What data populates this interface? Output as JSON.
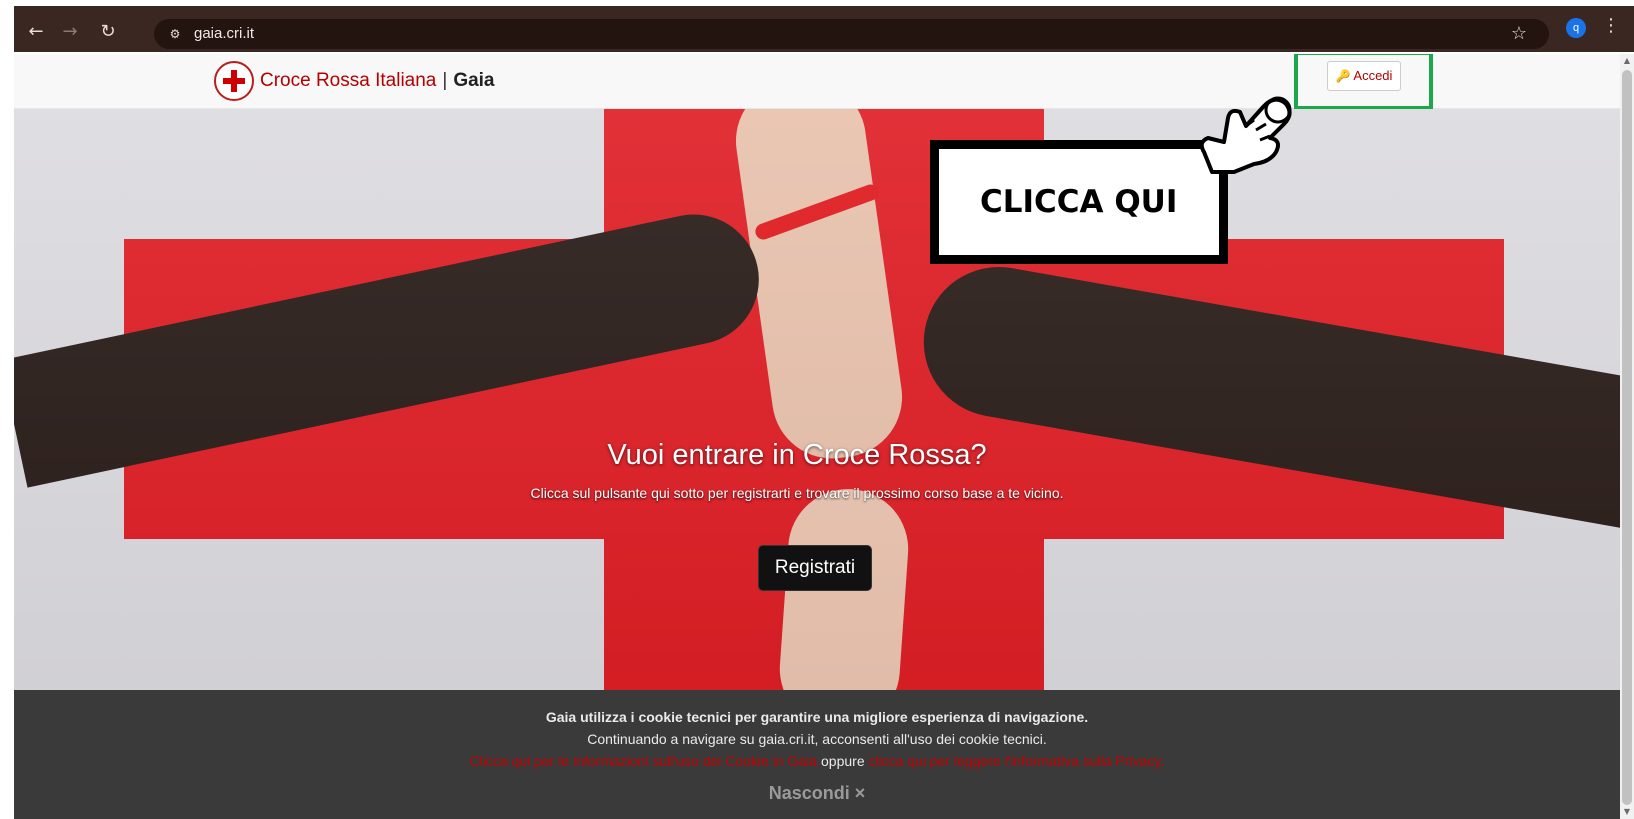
{
  "browser": {
    "back_icon": "←",
    "forward_icon": "→",
    "reload_icon": "↻",
    "site_info_icon": "⚙",
    "url": "gaia.cri.it",
    "star_icon": "☆",
    "profile_initial": "q",
    "menu_icon": "⋮"
  },
  "navbar": {
    "brand_name": "Croce Rossa Italiana",
    "separator": "|",
    "app_name": "Gaia",
    "login_icon": "🔑",
    "login_label": "Accedi"
  },
  "annotation": {
    "text": "CLICCA QUI",
    "highlight_color": "#1aa84a"
  },
  "hero": {
    "title": "Vuoi entrare in Croce Rossa?",
    "subtitle": "Clicca sul pulsante qui sotto per registrarti e trovare il prossimo corso base a te vicino.",
    "register_label": "Registrati"
  },
  "cookie_bar": {
    "line1": "Gaia utilizza i cookie tecnici per garantire una migliore esperienza di navigazione.",
    "line2": "Continuando a navigare su gaia.cri.it, acconsenti all'uso dei cookie tecnici.",
    "link1": "Clicca qui per le informazioni sull'uso dei Cookie in Gaia",
    "oppure": "oppure",
    "link2": "clicca qui per leggere l'informativa sulla Privacy.",
    "hide_label": "Nascondi ×"
  },
  "colors": {
    "brand_red": "#b40000",
    "cross_red": "#df1f26",
    "cookie_bg": "#3a3a3a"
  }
}
